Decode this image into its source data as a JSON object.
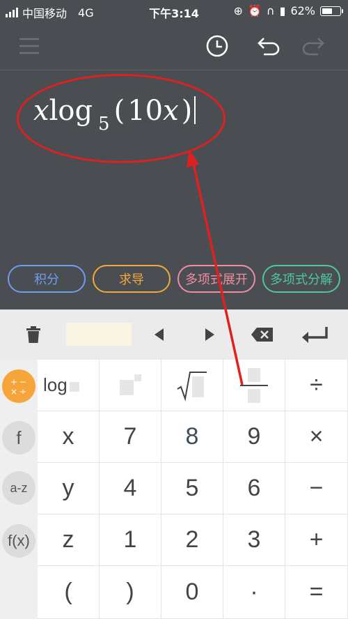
{
  "status": {
    "carrier": "中国移动",
    "network": "4G",
    "time": "下午3:14",
    "battery": "62%",
    "battery_level": 0.62
  },
  "toolbar": {
    "menu_icon": "menu-icon",
    "history_icon": "history-clock-icon",
    "undo_icon": "undo-icon",
    "redo_icon": "redo-icon"
  },
  "expression": {
    "coef": "x",
    "func": "log",
    "base": "5",
    "open": "(",
    "number": "10",
    "var": "x",
    "close": ")"
  },
  "chips": [
    {
      "label": "积分",
      "color": "#6f9cf0"
    },
    {
      "label": "求导",
      "color": "#f3a93c"
    },
    {
      "label": "多项式展开",
      "color": "#f28ca0"
    },
    {
      "label": "多项式分解",
      "color": "#4ec6a2"
    }
  ],
  "edit_bar": {
    "trash_icon": "trash-icon",
    "left_icon": "left-arrow-icon",
    "right_icon": "right-arrow-icon",
    "backspace_icon": "backspace-icon",
    "enter_icon": "enter-icon"
  },
  "side_keys": [
    {
      "label": "basic-ops-icon"
    },
    {
      "label": "f"
    },
    {
      "label": "a-z"
    },
    {
      "label": "f(x)"
    }
  ],
  "keys": {
    "log": "log",
    "x": "x",
    "k7": "7",
    "k8": "8",
    "k9": "9",
    "times": "×",
    "y": "y",
    "k4": "4",
    "k5": "5",
    "k6": "6",
    "minus": "−",
    "z": "z",
    "k1": "1",
    "k2": "2",
    "k3": "3",
    "plus": "+",
    "lparen": "(",
    "rparen": ")",
    "k0": "0",
    "dot": "·",
    "equals": "=",
    "divide": "÷"
  },
  "colors": {
    "accent": "#f5a53a",
    "annotation": "#e02020",
    "background": "#4a4e52"
  }
}
